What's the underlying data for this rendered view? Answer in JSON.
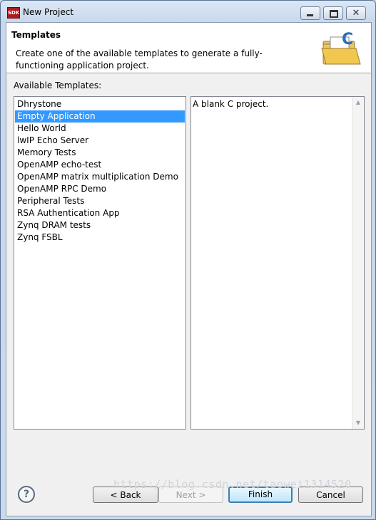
{
  "window": {
    "title": "New Project",
    "app_icon_text": "SDK"
  },
  "banner": {
    "title": "Templates",
    "description": "Create one of the available templates to generate a fully-functioning application project.",
    "icon": "c-folder-icon"
  },
  "templates": {
    "label": "Available Templates:",
    "items": [
      "Dhrystone",
      "Empty Application",
      "Hello World",
      "lwIP Echo Server",
      "Memory Tests",
      "OpenAMP echo-test",
      "OpenAMP matrix multiplication Demo",
      "OpenAMP RPC Demo",
      "Peripheral Tests",
      "RSA Authentication App",
      "Zynq DRAM tests",
      "Zynq FSBL"
    ],
    "selected": "Empty Application"
  },
  "description_box": {
    "text": "A blank C project."
  },
  "buttons": {
    "help": "?",
    "back": "< Back",
    "next": "Next >",
    "finish": "Finish",
    "cancel": "Cancel"
  },
  "watermark": "https://blog.csdn.net/taowei1314520",
  "colors": {
    "selection": "#3399ff",
    "default_button_border": "#3c7fb1",
    "app_icon": "#b0191d"
  }
}
